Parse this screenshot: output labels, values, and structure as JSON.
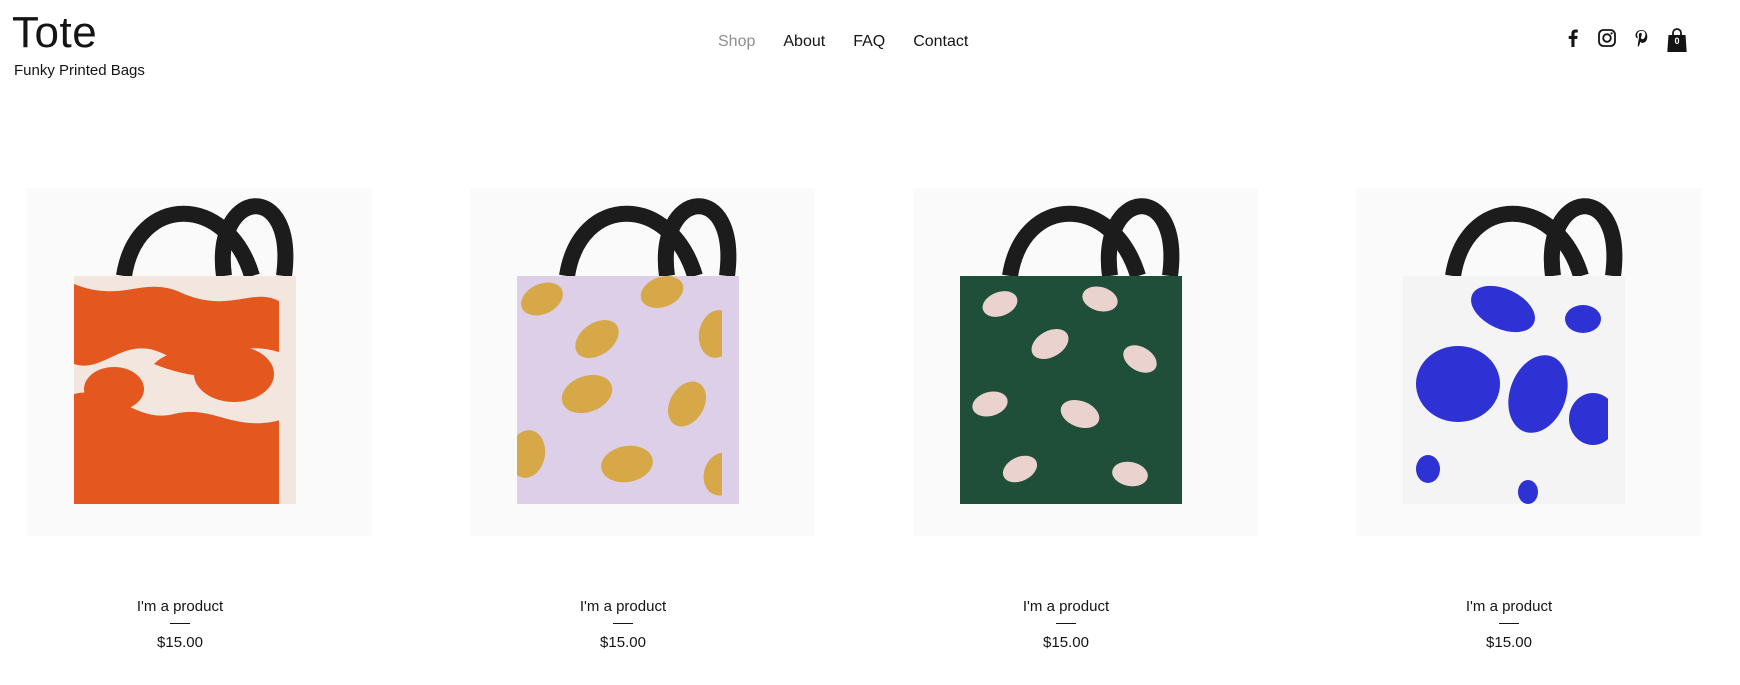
{
  "brand": {
    "title": "Tote",
    "subtitle": "Funky Printed Bags"
  },
  "nav": {
    "items": [
      "Shop",
      "About",
      "FAQ",
      "Contact"
    ],
    "active": "Shop"
  },
  "social": {
    "icons": [
      "facebook-icon",
      "instagram-icon",
      "pinterest-icon"
    ]
  },
  "cart": {
    "count": "0"
  },
  "products": [
    {
      "name": "I'm a product",
      "price": "$15.00",
      "pattern": "orange-brush",
      "colors": {
        "bg": "#f2e6df",
        "accent": "#e4581f"
      }
    },
    {
      "name": "I'm a product",
      "price": "$15.00",
      "pattern": "lemons",
      "colors": {
        "bg": "#ddcfe8",
        "accent": "#d7a847"
      }
    },
    {
      "name": "I'm a product",
      "price": "$15.00",
      "pattern": "hands",
      "colors": {
        "bg": "#1f4e39",
        "accent": "#ead3cf"
      }
    },
    {
      "name": "I'm a product",
      "price": "$15.00",
      "pattern": "blue-blobs",
      "colors": {
        "bg": "#f4f4f4",
        "accent": "#2e31d4"
      }
    }
  ]
}
